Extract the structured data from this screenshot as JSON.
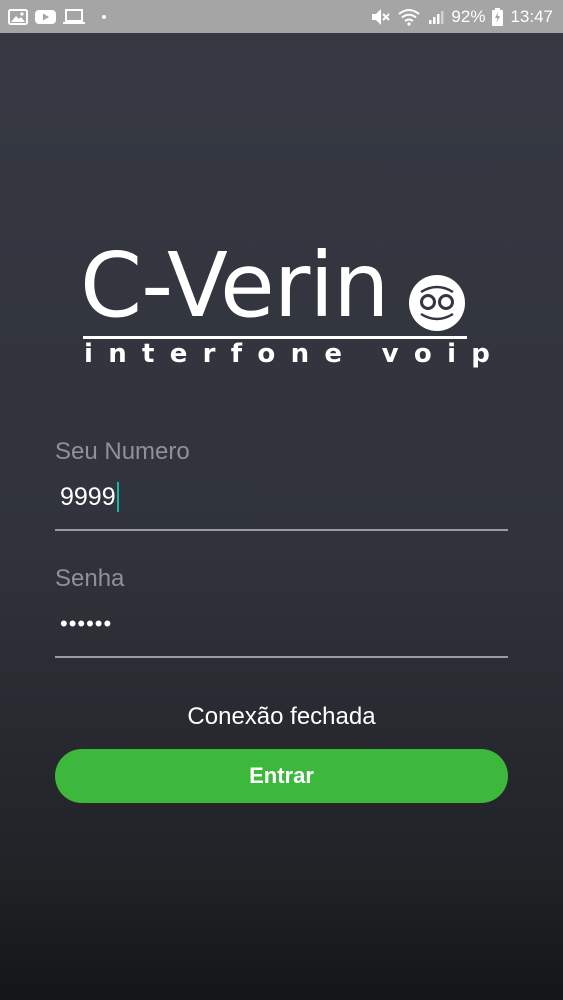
{
  "status_bar": {
    "icons_left": [
      "image-icon",
      "youtube-icon",
      "laptop-icon",
      "dot-icon"
    ],
    "icons_right": [
      "mute-icon",
      "wifi-icon",
      "signal-icon"
    ],
    "battery": "92%",
    "time": "13:47"
  },
  "logo": {
    "wordmark": "C-Verin",
    "tagline": "interfone voip"
  },
  "form": {
    "number": {
      "label": "Seu Numero",
      "value": "9999"
    },
    "password": {
      "label": "Senha",
      "value": "••••••"
    }
  },
  "status_message": "Conexão fechada",
  "button": {
    "label": "Entrar",
    "color": "#3db83c"
  },
  "colors": {
    "status_bar": "#a5a5a6",
    "background": "#34373f",
    "accent_caret": "#19b5a5"
  }
}
